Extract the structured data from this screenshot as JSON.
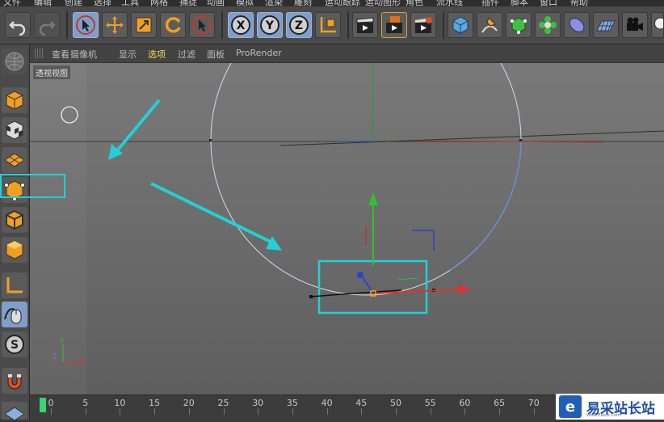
{
  "top_menu": [
    "文件",
    "编辑",
    "创建",
    "选择",
    "工具",
    "网格",
    "捕捉",
    "动画",
    "模拟",
    "渲染",
    "雕刻",
    "运动跟踪",
    "运动图形",
    "角色",
    "流水线",
    "插件",
    "脚本",
    "窗口",
    "帮助"
  ],
  "viewport_menu": {
    "items": [
      "查看",
      "摄像机",
      "显示",
      "选项",
      "过滤",
      "面板",
      "ProRender"
    ],
    "active_index": 3
  },
  "viewport": {
    "label": "透视视图",
    "axis_gizmo": {
      "y": "Y",
      "z": "Z",
      "x": "X"
    }
  },
  "toolbar": {
    "x_axis": "X",
    "y_axis": "Y",
    "z_axis": "Z"
  },
  "timeline": {
    "ticks": [
      "0",
      "5",
      "10",
      "15",
      "20",
      "25",
      "30",
      "35",
      "40",
      "45",
      "50",
      "55",
      "60",
      "65",
      "70"
    ],
    "playhead_frame": 0
  },
  "watermark": {
    "logo_char": "e",
    "text": "易采站长站",
    "subtext": "Www.Easck.Com"
  },
  "colors": {
    "highlight_box": "#22d0d8",
    "arrow": "#22d0d8",
    "menu_active": "#ffd54a",
    "axis_x": "#e03030",
    "axis_y": "#30c030",
    "axis_z": "#3040d0"
  }
}
